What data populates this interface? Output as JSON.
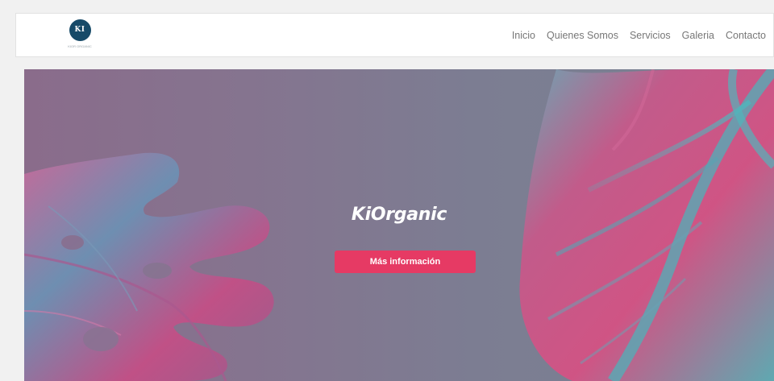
{
  "brand": {
    "logo_text": "KI",
    "tagline": "KIOR ORGANIC"
  },
  "nav": {
    "items": [
      {
        "label": "Inicio"
      },
      {
        "label": "Quienes Somos"
      },
      {
        "label": "Servicios"
      },
      {
        "label": "Galeria"
      },
      {
        "label": "Contacto"
      }
    ]
  },
  "hero": {
    "title": "KiOrganic",
    "button_label": "Más información"
  },
  "colors": {
    "accent": "#e63a64",
    "logo": "#174a68",
    "leaf_pink": "#c0507f",
    "leaf_teal": "#5aa2b0"
  }
}
